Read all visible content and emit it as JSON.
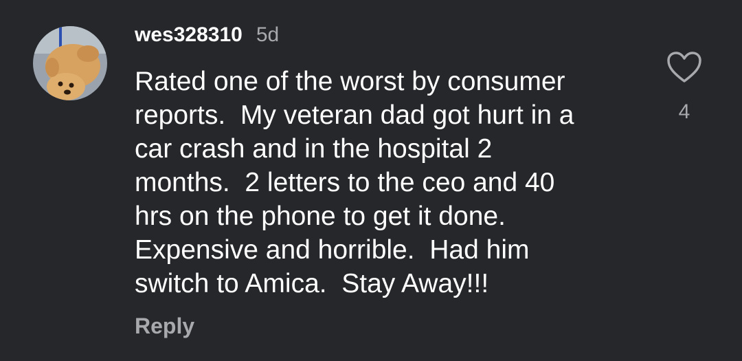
{
  "comment": {
    "username": "wes328310",
    "age": "5d",
    "text": "Rated one of the worst by consumer\nreports.  My veteran dad got hurt in a\ncar crash and in the hospital 2\nmonths.  2 letters to the ceo and 40\nhrs on the phone to get it done.\nExpensive and horrible.  Had him\nswitch to Amica.  Stay Away!!!",
    "reply_label": "Reply",
    "like_count": "4",
    "like_icon": "heart-outline-icon"
  },
  "colors": {
    "background": "#25272b",
    "primary_text": "#ffffff",
    "secondary_text": "#a7a9ad"
  }
}
